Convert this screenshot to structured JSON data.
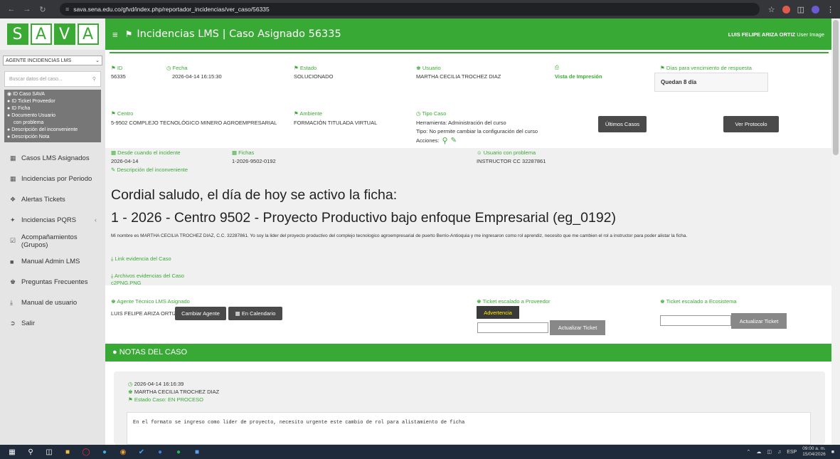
{
  "browser": {
    "url": "sava.sena.edu.co/gfvd/index.php/reportador_incidencias/ver_caso/56335"
  },
  "logo": {
    "letters": [
      "S",
      "A",
      "V",
      "A"
    ]
  },
  "header": {
    "title": "Incidencias LMS | Caso Asignado 56335",
    "user_name": "LUIS FELIPE ARIZA ORTIZ",
    "user_image": "User Image"
  },
  "sidebar": {
    "select_value": "AGENTE INCIDENCIAS LMS",
    "search_placeholder": "Buscar datos del caso...",
    "filters": [
      {
        "label": "ID Caso SAVA",
        "selected": true
      },
      {
        "label": "ID Ticket Proveedor",
        "selected": false
      },
      {
        "label": "ID Ficha",
        "selected": false
      },
      {
        "label": "Documento Usuario",
        "selected": false
      },
      {
        "label": "Descripción del inconveniente",
        "selected": false
      },
      {
        "label": "Descripción Nota",
        "selected": false
      }
    ],
    "filter_continuation": "con problema",
    "nav": [
      {
        "label": "Casos LMS Asignados",
        "icon": "calendar-icon"
      },
      {
        "label": "Incidencias por Periodo",
        "icon": "calendar-icon"
      },
      {
        "label": "Alertas Tickets",
        "icon": "alert-icon"
      },
      {
        "label": "Incidencias PQRS",
        "icon": "wrench-icon"
      },
      {
        "label": "Acompañamientos (Grupos)",
        "icon": "check-icon"
      },
      {
        "label": "Manual Admin LMS",
        "icon": "book-icon"
      },
      {
        "label": "Preguntas Frecuentes",
        "icon": "users-icon"
      },
      {
        "label": "Manual de usuario",
        "icon": "download-icon"
      },
      {
        "label": "Salir",
        "icon": "logout-icon"
      }
    ]
  },
  "case": {
    "id_label": "ID",
    "id_value": "56335",
    "fecha_label": "Fecha",
    "fecha_value": "2026-04-14 16:15:30",
    "estado_label": "Estado",
    "estado_value": "SOLUCIONADO",
    "usuario_label": "Usuario",
    "usuario_value": "MARTHA CECILIA TROCHEZ DIAZ",
    "print_link": "Vista de Impresión",
    "dias_label": "Días para vencimiento de respuesta",
    "dias_value": "Quedan 8 día",
    "centro_label": "Centro",
    "centro_value": "5-9502 COMPLEJO TECNOLÓGICO MINERO AGROEMPRESARIAL",
    "ambiente_label": "Ambiente",
    "ambiente_value": "FORMACIÓN TITULADA VIRTUAL",
    "tipo_label": "Tipo Caso",
    "herramienta": "Herramienta: Administración del curso",
    "tipo_detalle": "Tipo: No permite cambiar la configuración del curso",
    "acciones": "Acciones:",
    "ultimos_btn": "Últimos Casos",
    "protocolo_btn": "Ver Protocolo",
    "desde_label": "Desde cuando el incidente",
    "desde_value": "2026-04-14",
    "fichas_label": "Fichas",
    "fichas_value": "1-2026-9502-0192",
    "usuario_problema_label": "Usuario con problema",
    "usuario_problema_value": "INSTRUCTOR CC 32287861",
    "descripcion_label": "Descripción del inconveniente",
    "heading1": "Cordial saludo, el día de hoy se activo la ficha:",
    "heading2": "1 - 2026 - Centro 9502 - Proyecto Productivo bajo enfoque Empresarial (eg_0192)",
    "description": "Mi nombre es MARTHA CECILIA TROCHEZ DIAZ, C.C. 32287861. Yo soy la lider del proyecto productivo del complejo tecnologico agroempresarial de puerto Berrio-Antioquia y me ingresaron como rol aprendiz, necesito que me cambien el rol  a instructor para poder alistar la ficha.",
    "link_evidencia": "Link evidencia del Caso",
    "archivos_label": "Archivos evidencias del Caso",
    "archivo": "c2PNG.PNG",
    "agente_label": "Agente Técnico LMS Asignado",
    "agente_value": "LUIS FELIPE ARIZA ORTIZ",
    "cambiar_btn": "Cambiar Agente",
    "calendario_btn": "En Calendario",
    "ticket_prov_label": "Ticket escalado a Proveedor",
    "advertencia_btn": "Advertencia",
    "actualizar_btn": "Actualizar Ticket",
    "ticket_eco_label": "Ticket escalado a Ecosistema",
    "actualizar_btn2": "Actualizar Ticket"
  },
  "notes": {
    "title": "NOTAS DEL CASO",
    "items": [
      {
        "timestamp": "2026-04-14 16:16:39",
        "author": "MARTHA CECILIA TROCHEZ DIAZ",
        "estado": "Estado Caso: EN PROCESO",
        "text": "En el formato se ingreso como lider de proyecto, necesito urgente este cambio de rol para alistamiento de ficha"
      }
    ]
  },
  "taskbar": {
    "lang": "ESP",
    "time": "09:00 a. m.",
    "date": "15/04/2026"
  },
  "colors": {
    "accent": "#39a935",
    "sidebar": "#e5e5e5",
    "taskbar": "#1f2a3a"
  }
}
